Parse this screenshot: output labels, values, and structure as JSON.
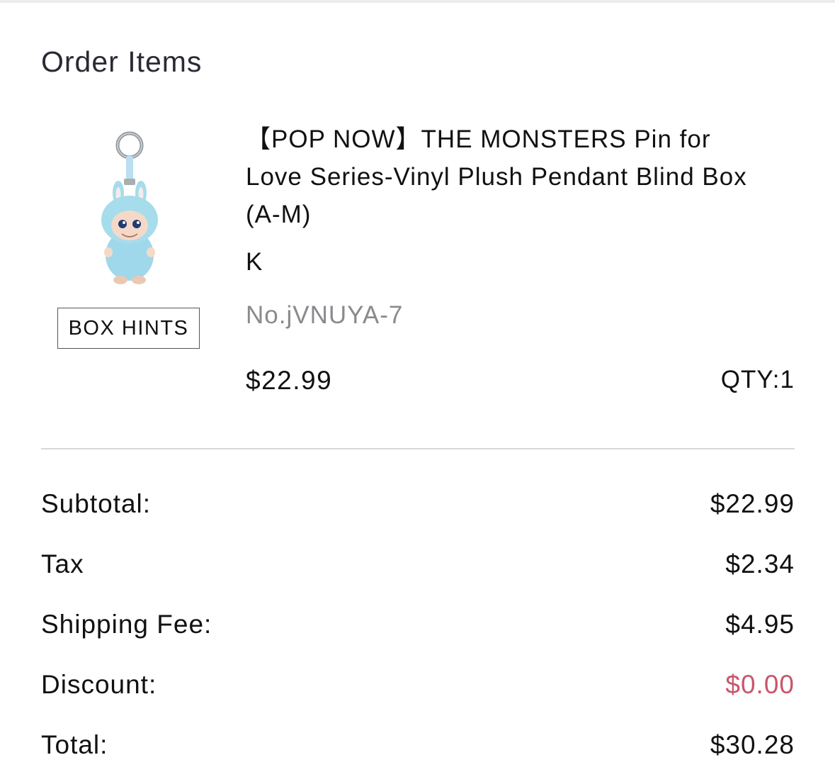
{
  "section_title": "Order Items",
  "item": {
    "image_icon": "labubu-blue-plush-keychain",
    "box_hints_label": "BOX HINTS",
    "name": "【POP NOW】THE MONSTERS Pin for Love Series-Vinyl Plush Pendant Blind Box (A-M)",
    "variant": "K",
    "number": "No.jVNUYA-7",
    "price": "$22.99",
    "qty": "QTY:1"
  },
  "summary": {
    "subtotal_label": "Subtotal:",
    "subtotal_value": "$22.99",
    "tax_label": "Tax",
    "tax_value": "$2.34",
    "shipping_label": "Shipping Fee:",
    "shipping_value": "$4.95",
    "discount_label": "Discount:",
    "discount_value": "$0.00",
    "total_label": "Total:",
    "total_value": "$30.28"
  },
  "colors": {
    "discount": "#c8566a",
    "muted_text": "#8a8a8e",
    "divider": "#d8d8da",
    "plush_blue": "#9fd8ea"
  }
}
